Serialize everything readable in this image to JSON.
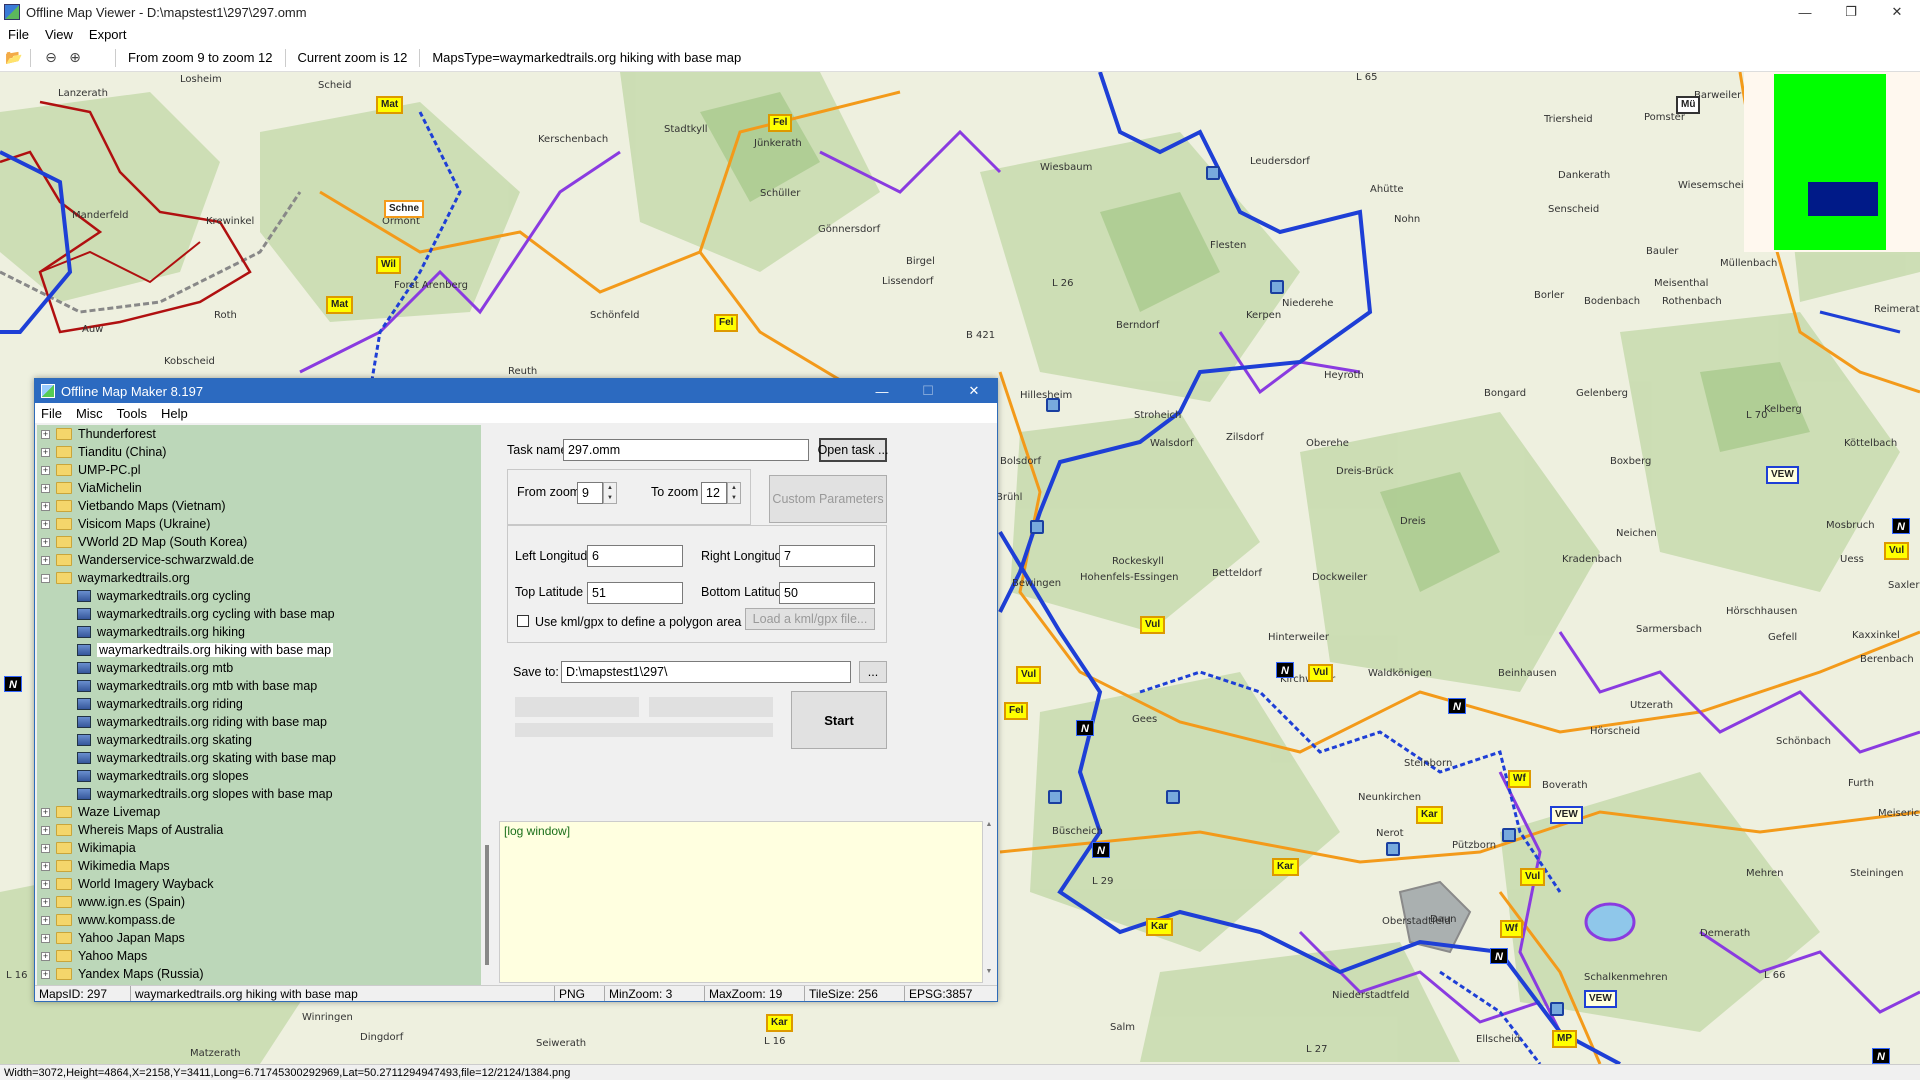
{
  "viewer": {
    "title": "Offline Map Viewer - D:\\mapstest1\\297\\297.omm",
    "menu": [
      "File",
      "View",
      "Export"
    ],
    "toolbar": {
      "zoom_range": "From zoom 9 to zoom 12",
      "current_zoom": "Current zoom is 12",
      "maps_type": "MapsType=waymarkedtrails.org hiking with base map"
    },
    "status": "Width=3072,Height=4864,X=2158,Y=3411,Long=6.71745300292969,Lat=50.2711294947493,file=12/2124/1384.png"
  },
  "map": {
    "places": [
      "Losheim",
      "Lanzerath",
      "Scheid",
      "Kerschenbach",
      "Stadtkyll",
      "Jünkerath",
      "Schüller",
      "Gönnersdorf",
      "Wiesbaum",
      "Leudersdorf",
      "Ahütte",
      "Nohn",
      "Triersheid",
      "Pomster",
      "Barweiler",
      "Dankerath",
      "Senscheid",
      "Wiesemscheid",
      "Manderfeld",
      "Krewinkel",
      "Forst Arenberg",
      "Ormont",
      "Roth",
      "Schönfeld",
      "Birgel",
      "Lissendorf",
      "Flesten",
      "Kerpen",
      "Niederehe",
      "Bauler",
      "Müllenbach",
      "Reimerath",
      "Meisenthal",
      "Borler",
      "Bodenbach",
      "Rothenbach",
      "Kobscheid",
      "Auw",
      "Reuth",
      "Hillesheim",
      "Berndorf",
      "Heyroth",
      "Bongard",
      "Gelenberg",
      "Kelberg",
      "Köttelbach",
      "Stroheich",
      "Walsdorf",
      "Zilsdorf",
      "Oberehe",
      "Dreis-Brück",
      "Boxberg",
      "Bolsdorf",
      "Brühl",
      "Mosbruch",
      "Rockeskyll",
      "Dreis",
      "Neichen",
      "Kradenbach",
      "Uess",
      "Saxler",
      "Hohenfels-Essingen",
      "Betteldorf",
      "Dockweiler",
      "Bewingen",
      "Sarmersbach",
      "Hörschhausen",
      "Gefell",
      "Kaxxinkel",
      "Berenbach",
      "Beinhausen",
      "Utzerath",
      "Hinterweiler",
      "Kirchweiler",
      "Waldkönigen",
      "Gees",
      "Hörscheid",
      "Schönbach",
      "Steinborn",
      "Boverath",
      "Neunkirchen",
      "Pützborn",
      "Nerot",
      "Furth",
      "Meiserich",
      "Steiningen",
      "Mehren",
      "Demerath",
      "Oberstadtfeld",
      "Büscheich",
      "Daun",
      "Schalkenmehren",
      "Niederstadtfeld",
      "Winringen",
      "Dingdorf",
      "Matzerath",
      "Seiwerath",
      "Salm",
      "Ellscheid"
    ],
    "badges": [
      "Mat",
      "Fel",
      "Schne",
      "Wil",
      "Mat",
      "Fel",
      "Mü",
      "VEW",
      "Vul",
      "Vul",
      "Vul",
      "Vul",
      "Fel",
      "Wf",
      "Kar",
      "Kar",
      "Vul",
      "Kar",
      "Wf",
      "Kar",
      "VEW",
      "VEW",
      "MP"
    ],
    "road_labels": [
      "L 65",
      "L 26",
      "B 421",
      "L 70",
      "L 29",
      "L 66",
      "L 16",
      "L 27",
      "L 16"
    ],
    "colors": {
      "hiking_blue": "#1e3fd6",
      "regional_purple": "#8a3be0",
      "local_orange": "#f39a1a",
      "border_red": "#b01010",
      "forest": "#c9dcb0",
      "field": "#eef0df"
    }
  },
  "maker": {
    "title": "Offline Map Maker 8.197",
    "menu": [
      "File",
      "Misc",
      "Tools",
      "Help"
    ],
    "tree": [
      {
        "label": "Thunderforest",
        "type": "folder"
      },
      {
        "label": "Tianditu (China)",
        "type": "folder"
      },
      {
        "label": "UMP-PC.pl",
        "type": "folder"
      },
      {
        "label": "ViaMichelin",
        "type": "folder"
      },
      {
        "label": "Vietbando Maps (Vietnam)",
        "type": "folder"
      },
      {
        "label": "Visicom Maps (Ukraine)",
        "type": "folder"
      },
      {
        "label": "VWorld 2D Map (South Korea)",
        "type": "folder"
      },
      {
        "label": "Wanderservice-schwarzwald.de",
        "type": "folder"
      },
      {
        "label": "waymarkedtrails.org",
        "type": "open"
      },
      {
        "label": "waymarkedtrails.org cycling",
        "type": "map"
      },
      {
        "label": "waymarkedtrails.org cycling with base map",
        "type": "map"
      },
      {
        "label": "waymarkedtrails.org hiking",
        "type": "map"
      },
      {
        "label": "waymarkedtrails.org hiking with base map",
        "type": "map",
        "selected": true
      },
      {
        "label": "waymarkedtrails.org mtb",
        "type": "map"
      },
      {
        "label": "waymarkedtrails.org mtb with base map",
        "type": "map"
      },
      {
        "label": "waymarkedtrails.org riding",
        "type": "map"
      },
      {
        "label": "waymarkedtrails.org riding with base map",
        "type": "map"
      },
      {
        "label": "waymarkedtrails.org skating",
        "type": "map"
      },
      {
        "label": "waymarkedtrails.org skating with base map",
        "type": "map"
      },
      {
        "label": "waymarkedtrails.org slopes",
        "type": "map"
      },
      {
        "label": "waymarkedtrails.org slopes with base map",
        "type": "map"
      },
      {
        "label": "Waze Livemap",
        "type": "folder"
      },
      {
        "label": "Whereis Maps of Australia",
        "type": "folder"
      },
      {
        "label": "Wikimapia",
        "type": "folder"
      },
      {
        "label": "Wikimedia Maps",
        "type": "folder"
      },
      {
        "label": "World Imagery Wayback",
        "type": "folder"
      },
      {
        "label": "www.ign.es (Spain)",
        "type": "folder"
      },
      {
        "label": "www.kompass.de",
        "type": "folder"
      },
      {
        "label": "Yahoo Japan Maps",
        "type": "folder"
      },
      {
        "label": "Yahoo Maps",
        "type": "folder"
      },
      {
        "label": "Yandex Maps (Russia)",
        "type": "folder"
      }
    ],
    "form": {
      "task_name_label": "Task name",
      "task_name_value": "297.omm",
      "open_task": "Open task ...",
      "from_zoom_label": "From zoom",
      "from_zoom_value": "9",
      "to_zoom_label": "To zoom",
      "to_zoom_value": "12",
      "custom_params": "Custom Parameters",
      "left_lon_label": "Left Longitude",
      "left_lon_value": "6",
      "right_lon_label": "Right Longitude",
      "right_lon_value": "7",
      "top_lat_label": "Top Latitude",
      "top_lat_value": "51",
      "bottom_lat_label": "Bottom Latitude",
      "bottom_lat_value": "50",
      "kml_label": "Use kml/gpx to define a polygon area",
      "load_kml": "Load a kml/gpx file...",
      "save_to_label": "Save to:",
      "save_to_value": "D:\\mapstest1\\297\\",
      "browse": "...",
      "start": "Start",
      "log": "[log window]"
    },
    "status": {
      "maps_id": "MapsID: 297",
      "maps_name": "waymarkedtrails.org hiking with base map",
      "format": "PNG",
      "min_zoom": "MinZoom: 3",
      "max_zoom": "MaxZoom: 19",
      "tile_size": "TileSize: 256",
      "epsg": "EPSG:3857"
    }
  }
}
